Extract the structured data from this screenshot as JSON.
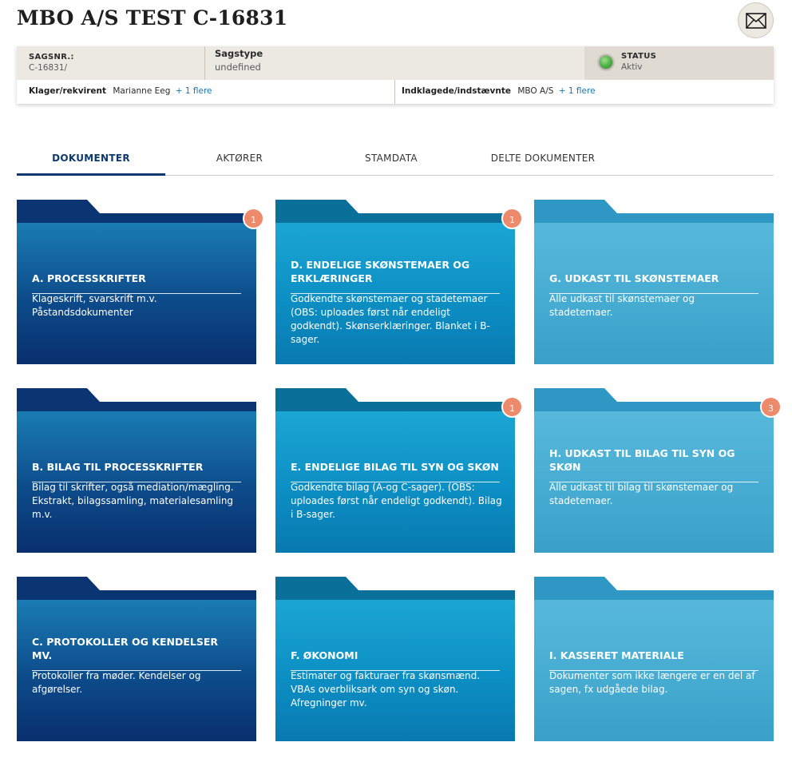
{
  "page": {
    "title": "MBO A/S TEST C-16831"
  },
  "header": {
    "mail_icon": "envelope-icon"
  },
  "case": {
    "sagsnr_label": "SAGSNR.:",
    "sagsnr_value": "C-16831/",
    "sagstype_label": "Sagstype",
    "sagstype_value": "undefined",
    "status_label": "STATUS",
    "status_value": "Aktiv",
    "status_color": "#4fb548",
    "klager_label": "Klager/rekvirent",
    "klager_name": "Marianne Eeg",
    "klager_more": "+ 1 flere",
    "indklagede_label": "Indklagede/indstævnte",
    "indklagede_name": "MBO A/S",
    "indklagede_more": "+ 1 flere"
  },
  "tabs": [
    {
      "label": "DOKUMENTER",
      "active": true
    },
    {
      "label": "AKTØRER",
      "active": false
    },
    {
      "label": "STAMDATA",
      "active": false
    },
    {
      "label": "DELTE DOKUMENTER",
      "active": false
    }
  ],
  "colors": {
    "navy": "#0d3a6e",
    "blue": "#0c8fc4",
    "light_blue": "#47acd2",
    "badge": "#ee8a6c"
  },
  "folders": [
    {
      "title": "A. PROCESSKRIFTER",
      "description": "Klageskrift, svarskrift m.v. Påstandsdokumenter",
      "badge": "1"
    },
    {
      "title": "D. ENDELIGE SKØNSTEMAER OG ERKLÆRINGER",
      "description": "Godkendte skønstemaer og stadetemaer (OBS: uploades først når endeligt godkendt). Skønserklæringer. Blanket i B-sager.",
      "badge": "1"
    },
    {
      "title": "G. UDKAST TIL SKØNSTEMAER",
      "description": "Alle udkast til skønstemaer og stadetemaer.",
      "badge": ""
    },
    {
      "title": "B. BILAG TIL PROCESSKRIFTER",
      "description": "Bilag til skrifter, også mediation/mægling. Ekstrakt, bilagssamling, materialesamling m.v.",
      "badge": ""
    },
    {
      "title": "E. ENDELIGE BILAG TIL SYN OG SKØN",
      "description": "Godkendte bilag (A-og C-sager). (OBS: uploades først når endeligt godkendt). Bilag i B-sager.",
      "badge": "1"
    },
    {
      "title": "H. UDKAST TIL BILAG TIL SYN OG SKØN",
      "description": "Alle udkast til bilag til skønstemaer og stadetemaer.",
      "badge": "3"
    },
    {
      "title": "C. PROTOKOLLER OG KENDELSER MV.",
      "description": "Protokoller fra møder. Kendelser og afgørelser.",
      "badge": ""
    },
    {
      "title": "F. ØKONOMI",
      "description": "Estimater og fakturaer fra skønsmænd. VBAs overbliksark om syn og skøn. Afregninger mv.",
      "badge": ""
    },
    {
      "title": "I. KASSERET MATERIALE",
      "description": "Dokumenter som ikke længere er en del af sagen, fx udgåede bilag.",
      "badge": ""
    }
  ]
}
